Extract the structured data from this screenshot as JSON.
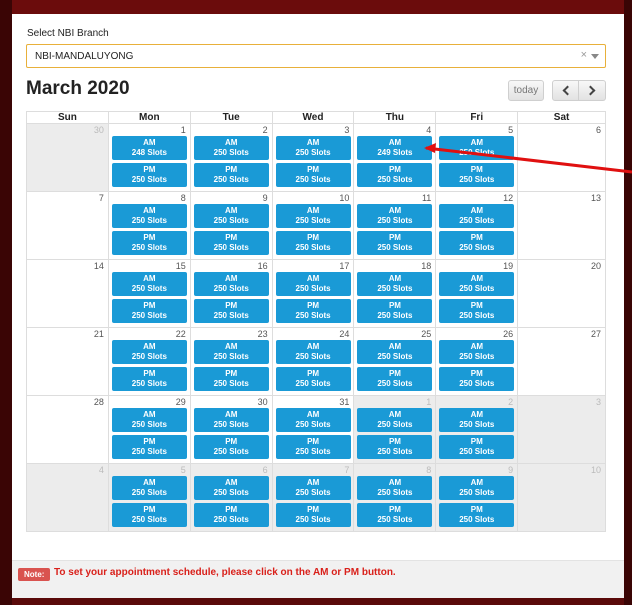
{
  "branch": {
    "label": "Select NBI Branch",
    "value": "NBI-MANDALUYONG",
    "clear": "×"
  },
  "calendar": {
    "title": "March 2020",
    "today_label": "today",
    "weekdays": [
      "Sun",
      "Mon",
      "Tue",
      "Wed",
      "Thu",
      "Fri",
      "Sat"
    ],
    "weeks": [
      [
        {
          "d": "30",
          "other": true
        },
        {
          "d": "1",
          "am": "248 Slots",
          "pm": "250 Slots"
        },
        {
          "d": "2",
          "am": "250 Slots",
          "pm": "250 Slots"
        },
        {
          "d": "3",
          "am": "250 Slots",
          "pm": "250 Slots"
        },
        {
          "d": "4",
          "am": "249 Slots",
          "pm": "250 Slots"
        },
        {
          "d": "5",
          "am": "250 Slots",
          "pm": "250 Slots"
        },
        {
          "d": "6"
        }
      ],
      [
        {
          "d": "7"
        },
        {
          "d": "8",
          "am": "250 Slots",
          "pm": "250 Slots"
        },
        {
          "d": "9",
          "am": "250 Slots",
          "pm": "250 Slots"
        },
        {
          "d": "10",
          "am": "250 Slots",
          "pm": "250 Slots"
        },
        {
          "d": "11",
          "am": "250 Slots",
          "pm": "250 Slots"
        },
        {
          "d": "12",
          "am": "250 Slots",
          "pm": "250 Slots"
        },
        {
          "d": "13"
        }
      ],
      [
        {
          "d": "14"
        },
        {
          "d": "15",
          "am": "250 Slots",
          "pm": "250 Slots"
        },
        {
          "d": "16",
          "am": "250 Slots",
          "pm": "250 Slots"
        },
        {
          "d": "17",
          "am": "250 Slots",
          "pm": "250 Slots"
        },
        {
          "d": "18",
          "am": "250 Slots",
          "pm": "250 Slots"
        },
        {
          "d": "19",
          "am": "250 Slots",
          "pm": "250 Slots"
        },
        {
          "d": "20"
        }
      ],
      [
        {
          "d": "21"
        },
        {
          "d": "22",
          "am": "250 Slots",
          "pm": "250 Slots"
        },
        {
          "d": "23",
          "am": "250 Slots",
          "pm": "250 Slots"
        },
        {
          "d": "24",
          "am": "250 Slots",
          "pm": "250 Slots"
        },
        {
          "d": "25",
          "am": "250 Slots",
          "pm": "250 Slots"
        },
        {
          "d": "26",
          "am": "250 Slots",
          "pm": "250 Slots"
        },
        {
          "d": "27"
        }
      ],
      [
        {
          "d": "28"
        },
        {
          "d": "29",
          "am": "250 Slots",
          "pm": "250 Slots"
        },
        {
          "d": "30",
          "am": "250 Slots",
          "pm": "250 Slots"
        },
        {
          "d": "31",
          "am": "250 Slots",
          "pm": "250 Slots"
        },
        {
          "d": "1",
          "other": true,
          "am": "250 Slots",
          "pm": "250 Slots"
        },
        {
          "d": "2",
          "other": true,
          "am": "250 Slots",
          "pm": "250 Slots"
        },
        {
          "d": "3",
          "other": true
        }
      ],
      [
        {
          "d": "4",
          "other": true
        },
        {
          "d": "5",
          "other": true,
          "am": "250 Slots",
          "pm": "250 Slots"
        },
        {
          "d": "6",
          "other": true,
          "am": "250 Slots",
          "pm": "250 Slots"
        },
        {
          "d": "7",
          "other": true,
          "am": "250 Slots",
          "pm": "250 Slots"
        },
        {
          "d": "8",
          "other": true,
          "am": "250 Slots",
          "pm": "250 Slots"
        },
        {
          "d": "9",
          "other": true,
          "am": "250 Slots",
          "pm": "250 Slots"
        },
        {
          "d": "10",
          "other": true
        }
      ]
    ],
    "am_label": "AM",
    "pm_label": "PM"
  },
  "note": {
    "badge": "Note:",
    "text": "To set your appointment schedule, please click on the AM or PM button."
  },
  "colors": {
    "slot": "#1a9ad6",
    "frame": "#5a0a0a",
    "note": "#d9201a",
    "arrow": "#e01010"
  }
}
